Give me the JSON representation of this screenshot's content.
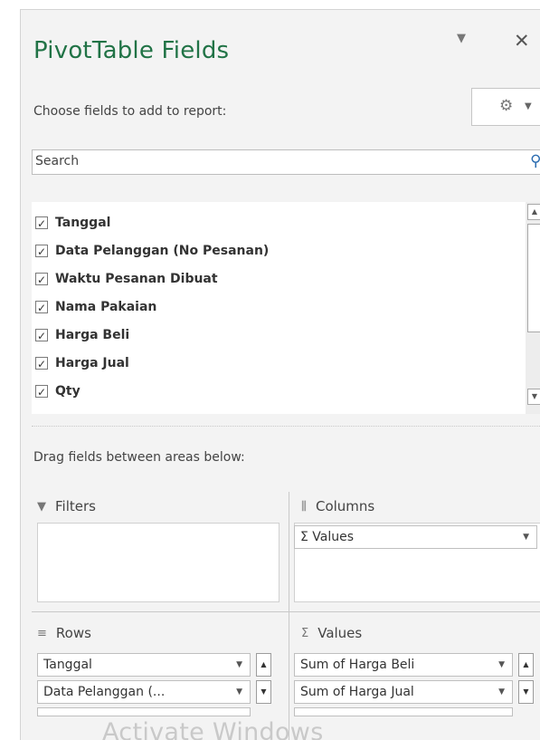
{
  "header": {
    "title": "PivotTable Fields",
    "dropdown_glyph": "▼",
    "close_glyph": "✕"
  },
  "choose_label": "Choose fields to add to report:",
  "tools_button": {
    "icon": "gear-icon",
    "glyph": "⚙",
    "caret": "▼"
  },
  "search": {
    "value": "Search",
    "icon": "search-icon"
  },
  "fields": [
    {
      "label": "Tanggal",
      "checked": true
    },
    {
      "label": "Data Pelanggan (No Pesanan)",
      "checked": true
    },
    {
      "label": "Waktu Pesanan Dibuat",
      "checked": true
    },
    {
      "label": "Nama Pakaian",
      "checked": true
    },
    {
      "label": "Harga Beli",
      "checked": true
    },
    {
      "label": "Harga Jual",
      "checked": true
    },
    {
      "label": "Qty",
      "checked": true
    }
  ],
  "check_glyph": "✓",
  "drag_label": "Drag fields between areas below:",
  "areas": {
    "filters": {
      "label": "Filters",
      "icon": "filter-icon",
      "glyph": "▼",
      "items": []
    },
    "columns": {
      "label": "Columns",
      "icon": "columns-icon",
      "glyph": "⫼",
      "items": [
        "Σ  Values"
      ]
    },
    "rows": {
      "label": "Rows",
      "icon": "rows-icon",
      "glyph": "≡",
      "items": [
        "Tanggal",
        "Data Pelanggan (..."
      ]
    },
    "values": {
      "label": "Values",
      "icon": "sigma-icon",
      "glyph": "Σ",
      "items": [
        "Sum of Harga Beli",
        "Sum of Harga Jual"
      ]
    }
  },
  "item_dropdown_glyph": "▼",
  "spin_up": "▲",
  "spin_down": "▼",
  "watermark": "Activate Windows",
  "colors": {
    "title": "#217346",
    "search_icon": "#2b6cb0",
    "pane_bg": "#f3f3f3"
  }
}
